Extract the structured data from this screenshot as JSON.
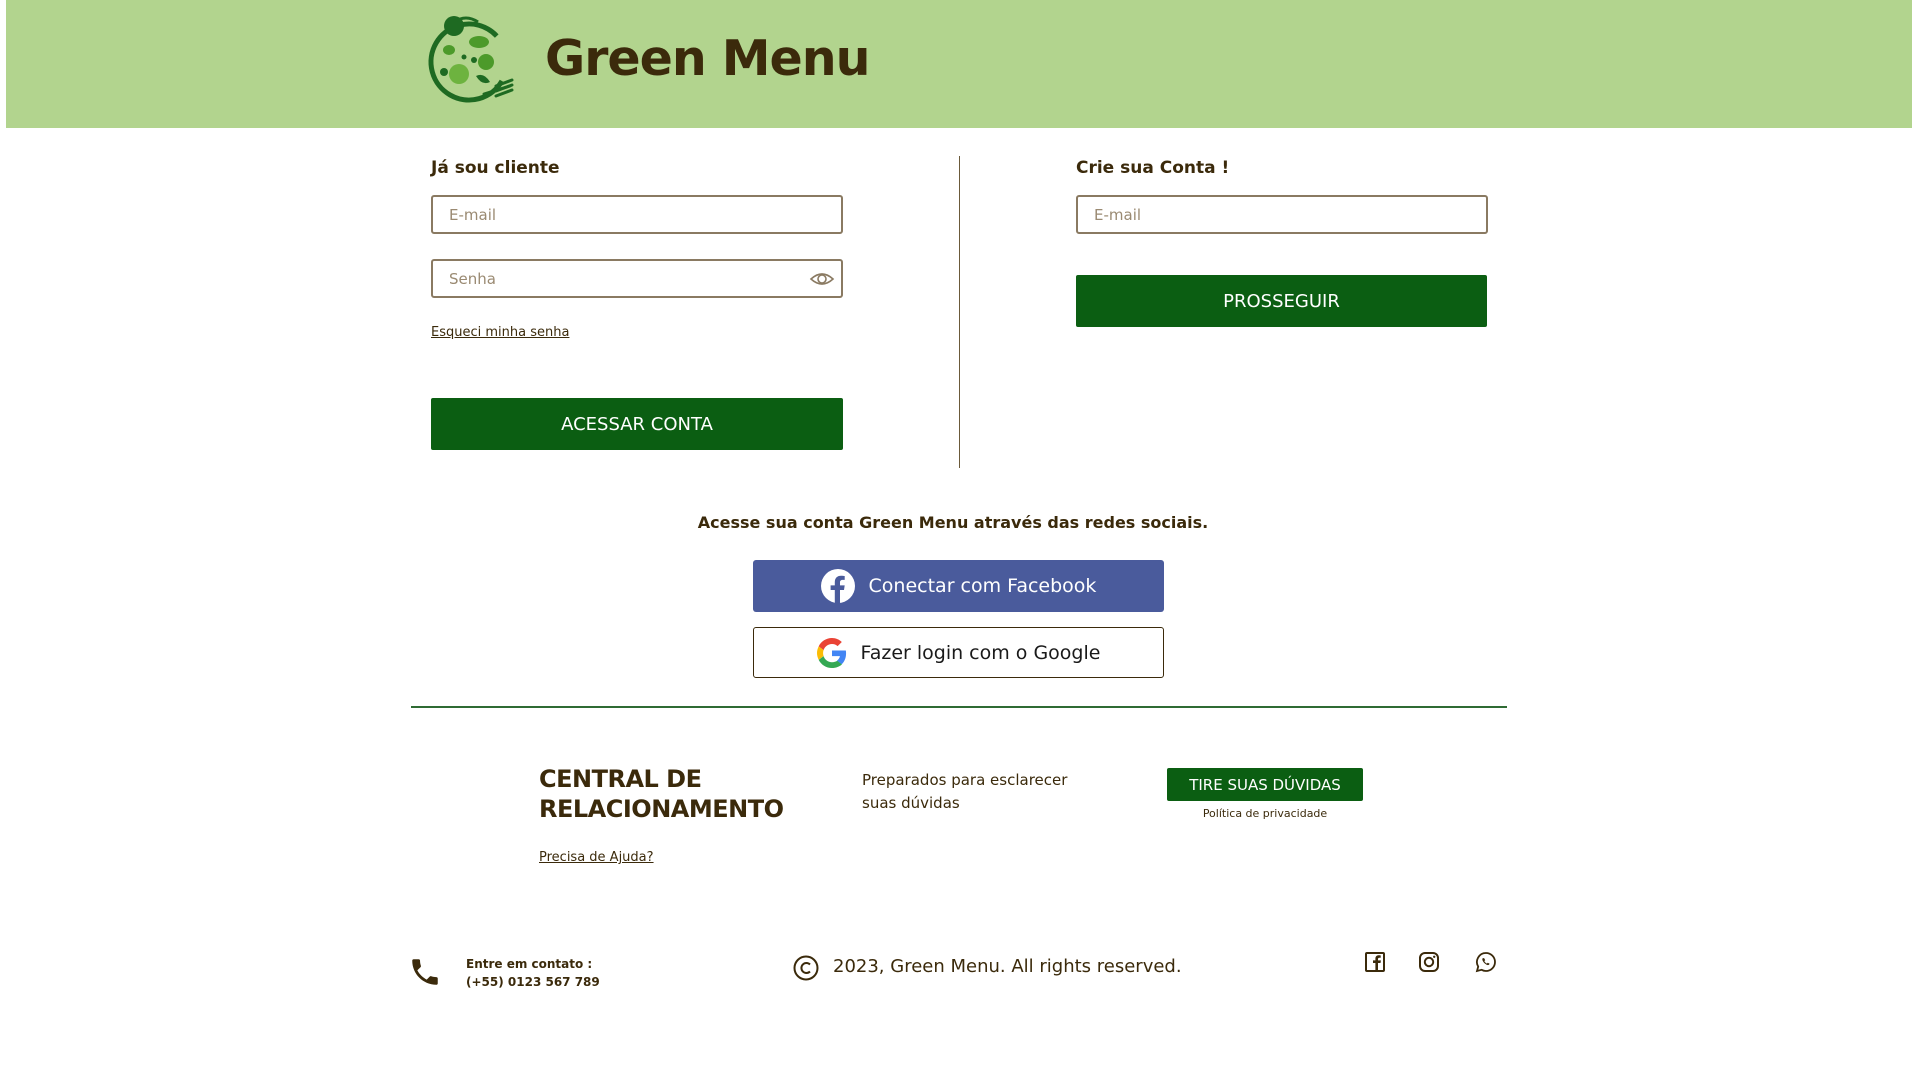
{
  "header": {
    "brand": "Green Menu",
    "logo_icon": "salad-bowl-logo-icon",
    "background_color": "#b2d48e"
  },
  "login": {
    "title": "Já sou cliente",
    "email_placeholder": "E-mail",
    "password_placeholder": "Senha",
    "forgot_password": "Esqueci minha senha",
    "submit_label": "ACESSAR CONTA"
  },
  "signup": {
    "title": "Crie sua Conta !",
    "email_placeholder": "E-mail",
    "submit_label": "PROSSEGUIR"
  },
  "social": {
    "title": "Acesse sua conta Green Menu através das redes sociais.",
    "facebook_label": "Conectar com Facebook",
    "google_label": "Fazer login com o Google",
    "facebook_color": "#4a5b9c"
  },
  "support": {
    "title_line1": "CENTRAL DE",
    "title_line2": "RELACIONAMENTO",
    "help_link": "Precisa de Ajuda?",
    "description_line1": "Preparados para esclarecer",
    "description_line2": "suas dúvidas",
    "doubt_button": "TIRE SUAS DÚVIDAS",
    "privacy_link": "Política de privacidade"
  },
  "footer": {
    "contact_label": "Entre em contato :",
    "contact_phone": "(+55) 0123 567 789",
    "copyright": "2023, Green Menu. All rights reserved.",
    "social_icons": [
      "facebook-icon",
      "instagram-icon",
      "whatsapp-icon"
    ]
  },
  "colors": {
    "primary_green": "#0b5e12",
    "text_brown": "#3b2a0b"
  }
}
